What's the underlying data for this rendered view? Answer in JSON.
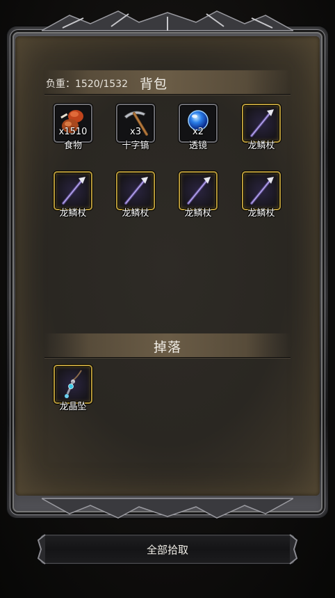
{
  "bag": {
    "title": "背包",
    "load_label": "负重：1520/1532",
    "items": [
      {
        "name": "食物",
        "qty": "x1510",
        "icon": "food-icon",
        "rarity": "normal"
      },
      {
        "name": "十字镐",
        "qty": "x3",
        "icon": "pickaxe-icon",
        "rarity": "normal"
      },
      {
        "name": "透镜",
        "qty": "x2",
        "icon": "lens-icon",
        "rarity": "normal"
      },
      {
        "name": "龙鳞杖",
        "qty": "",
        "icon": "dragon-staff-icon",
        "rarity": "gold"
      },
      {
        "name": "龙鳞杖",
        "qty": "",
        "icon": "dragon-staff-icon",
        "rarity": "gold"
      },
      {
        "name": "龙鳞杖",
        "qty": "",
        "icon": "dragon-staff-icon",
        "rarity": "gold"
      },
      {
        "name": "龙鳞杖",
        "qty": "",
        "icon": "dragon-staff-icon",
        "rarity": "gold"
      },
      {
        "name": "龙鳞杖",
        "qty": "",
        "icon": "dragon-staff-icon",
        "rarity": "gold"
      }
    ]
  },
  "drop": {
    "title": "掉落",
    "items": [
      {
        "name": "龙晶坠",
        "qty": "",
        "icon": "dragon-crystal-pendant-icon",
        "rarity": "gold"
      }
    ]
  },
  "actions": {
    "pickup_all_label": "全部拾取"
  },
  "colors": {
    "gold_border": "#b89a3a",
    "gray_border": "#6d6d72",
    "text": "#f2efe8"
  }
}
